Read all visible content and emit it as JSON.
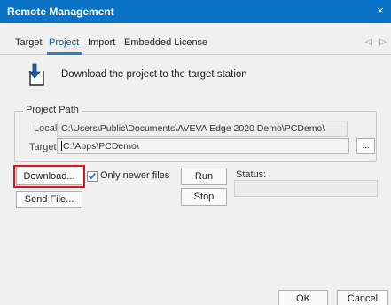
{
  "window": {
    "title": "Remote Management",
    "close_glyph": "×"
  },
  "tabs": [
    {
      "label": "Target",
      "active": false
    },
    {
      "label": "Project",
      "active": true
    },
    {
      "label": "Import",
      "active": false
    },
    {
      "label": "Embedded License",
      "active": false
    }
  ],
  "tab_scroll": {
    "left": "◁",
    "right": "▷"
  },
  "header": {
    "icon": "download-arrow-icon",
    "description": "Download the project to the target station"
  },
  "project_path": {
    "group_label": "Project Path",
    "local_label": "Local:",
    "local_value": "C:\\Users\\Public\\Documents\\AVEVA Edge 2020 Demo\\PCDemo\\",
    "target_label": "Target:",
    "target_value": "C:\\Apps\\PCDemo\\",
    "browse_label": "..."
  },
  "actions": {
    "download_label": "Download...",
    "send_file_label": "Send File...",
    "only_newer_label": "Only newer files",
    "only_newer_checked": true,
    "run_label": "Run",
    "stop_label": "Stop",
    "status_label": "Status:",
    "status_value": ""
  },
  "footer": {
    "ok_label": "OK",
    "cancel_label": "Cancel"
  },
  "colors": {
    "titlebar": "#0a72c7",
    "tab_accent": "#2e7fd1",
    "highlight": "#e0141c"
  }
}
